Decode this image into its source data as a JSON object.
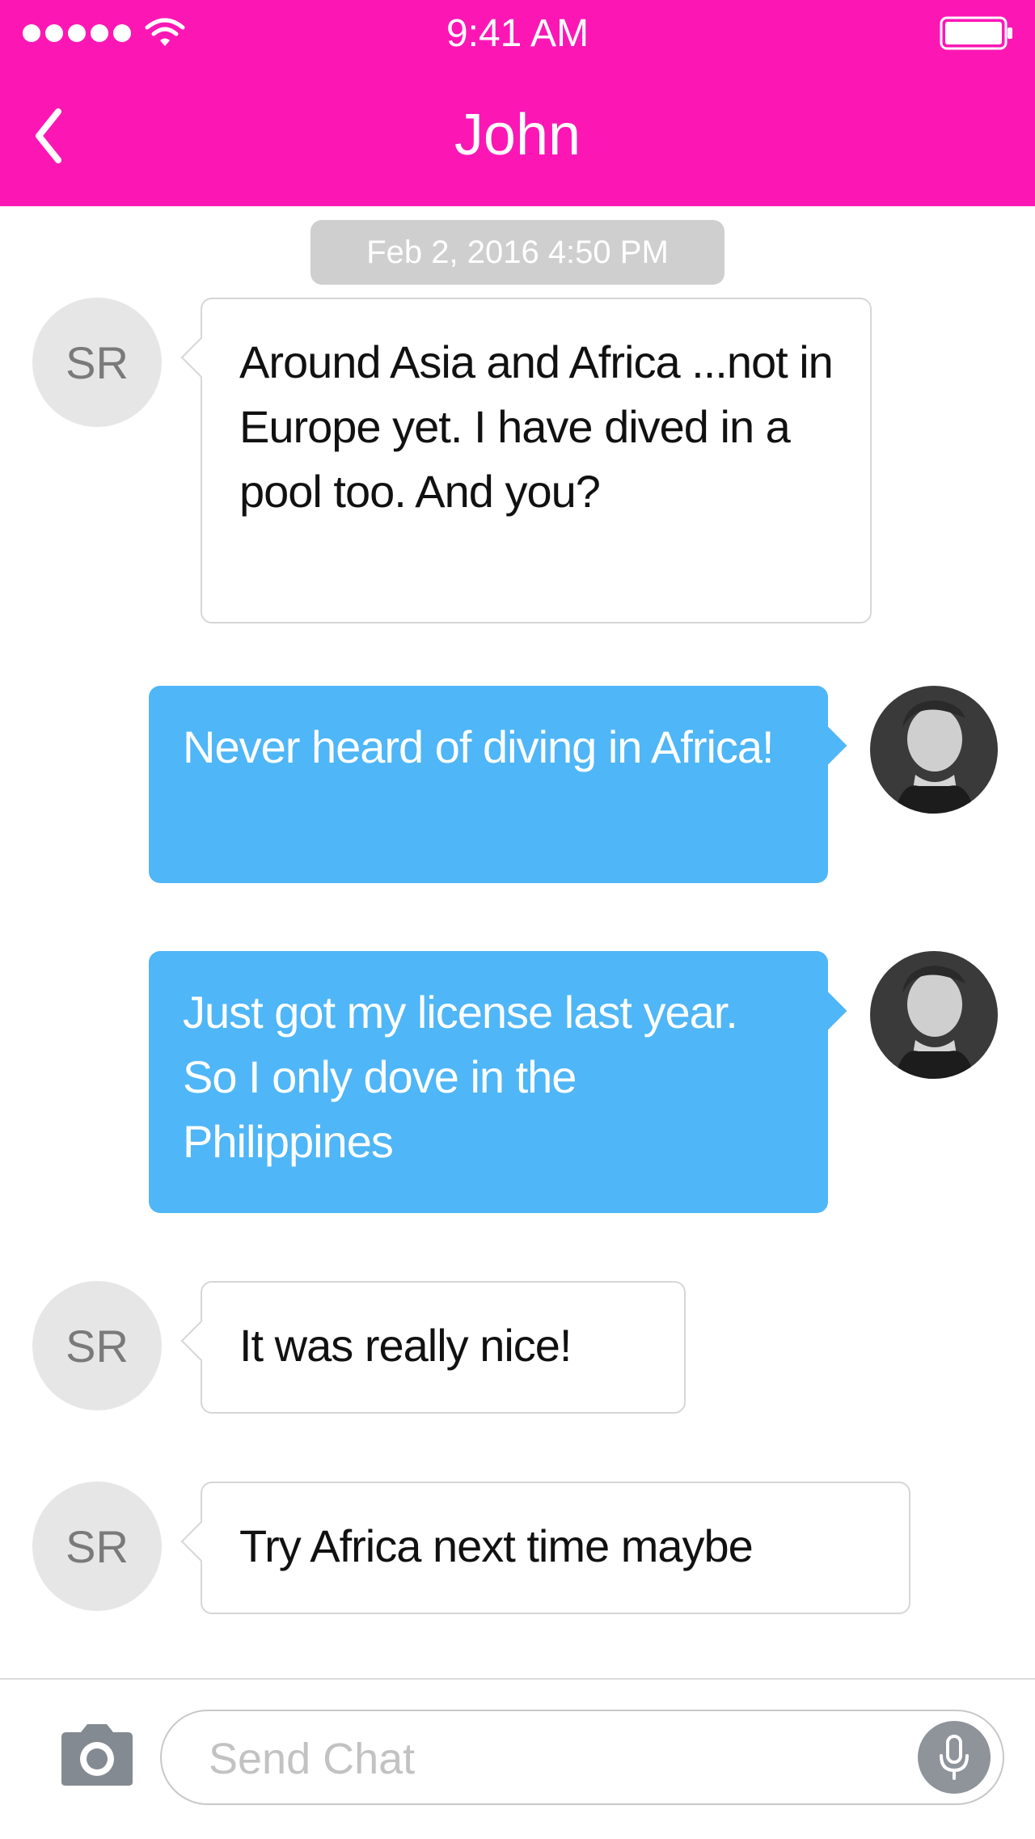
{
  "status_bar": {
    "time": "9:41 AM"
  },
  "header": {
    "title": "John"
  },
  "theme": {
    "accent": "#fc17b5",
    "outgoing_bubble": "#4fb6f7",
    "incoming_bubble": "#ffffff"
  },
  "conversation": {
    "date_label": "Feb 2, 2016 4:50 PM",
    "messages": [
      {
        "direction": "incoming",
        "avatar_initials": "SR",
        "text": "Around Asia and Africa ...not in Europe yet. I have dived in a pool too. And you?"
      },
      {
        "direction": "outgoing",
        "text": "Never heard of diving in Africa!"
      },
      {
        "direction": "outgoing",
        "text": "Just got my license last year. So I only dove in the Philippines"
      },
      {
        "direction": "incoming",
        "avatar_initials": "SR",
        "text": "It was really nice!"
      },
      {
        "direction": "incoming",
        "avatar_initials": "SR",
        "text": "Try Africa next time maybe"
      }
    ]
  },
  "composer": {
    "placeholder": "Send Chat",
    "value": ""
  },
  "icons": {
    "back": "chevron-left-icon",
    "camera": "camera-icon",
    "mic": "microphone-icon",
    "wifi": "wifi-icon",
    "battery": "battery-icon",
    "signal": "signal-dots-icon"
  }
}
